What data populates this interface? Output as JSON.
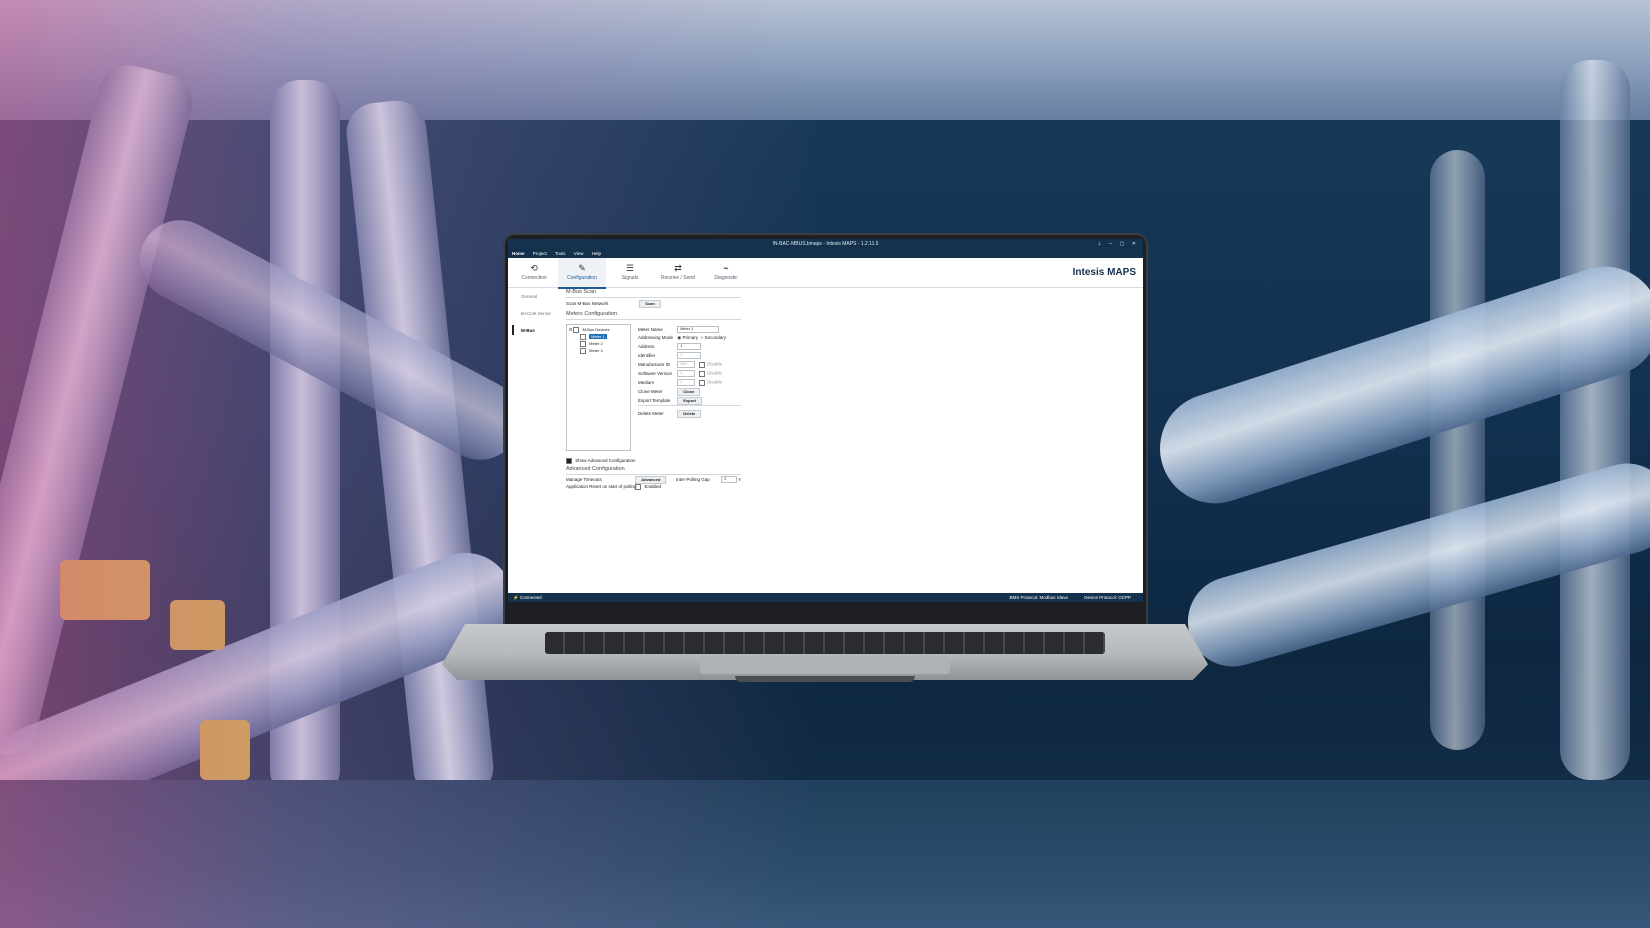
{
  "window": {
    "title": "IN-BAC-MBUS.bmaps - Intesis MAPS - 1.2.11.5",
    "controls": "⊥ ─ ▢ ✕"
  },
  "menu": [
    "Home",
    "Project",
    "Tools",
    "View",
    "Help"
  ],
  "ribbon": {
    "tabs": [
      {
        "label": "Connection",
        "icon": "plug-icon",
        "glyph": "⟲"
      },
      {
        "label": "Configuration",
        "icon": "wrench-icon",
        "glyph": "🔧",
        "active": true
      },
      {
        "label": "Signals",
        "icon": "list-icon",
        "glyph": "☰"
      },
      {
        "label": "Receive / Send",
        "icon": "transfer-icon",
        "glyph": "⇄"
      },
      {
        "label": "Diagnostic",
        "icon": "pulse-icon",
        "glyph": "⌁"
      }
    ],
    "brand": "Intesis MAPS"
  },
  "sidebar": {
    "items": [
      {
        "label": "General"
      },
      {
        "label": "BACnet Server"
      },
      {
        "label": "M-Bus",
        "active": true
      }
    ]
  },
  "main": {
    "scan_section": "M-Bus Scan",
    "scan_label": "Scan M-Bus Network",
    "scan_button": "Scan",
    "meters_section": "Meters Configuration",
    "tree": {
      "root": "M-Bus Devices",
      "items": [
        "Meter 1",
        "Meter 2",
        "Meter 3"
      ]
    },
    "form": {
      "meter_name_label": "Meter Name",
      "meter_name_value": "Meter 1",
      "addressing_label": "Addressing Mode",
      "primary": "Primary",
      "secondary": "Secondary",
      "address_label": "Address",
      "address_value": "1",
      "identifier_label": "Identifier",
      "identifier_value": "1",
      "manufacturer_label": "Manufacturer ID",
      "manufacturer_value": "000",
      "software_label": "Software Version",
      "software_value": "1",
      "medium_label": "Medium",
      "medium_value": "1",
      "disable": "Disable",
      "clone_label": "Clone Meter",
      "clone_button": "Clone",
      "export_label": "Export Template",
      "export_button": "Export",
      "delete_label": "Delete Meter",
      "delete_button": "Delete"
    },
    "show_advanced": "Show Advanced Configuration",
    "advanced_section": "Advanced Configuration",
    "timeouts_label": "Manage Timeouts",
    "timeouts_button": "Advanced",
    "polling_gap_label": "Inter-Polling Gap",
    "polling_gap_value": "2",
    "polling_gap_unit": "s",
    "reset_label": "Application Reset on start of  polling",
    "reset_value": "Enabled"
  },
  "status": {
    "left": "Connected",
    "bms": "BMS Protocol: Modbus Slave",
    "device": "Device Protocol: OCPP"
  }
}
